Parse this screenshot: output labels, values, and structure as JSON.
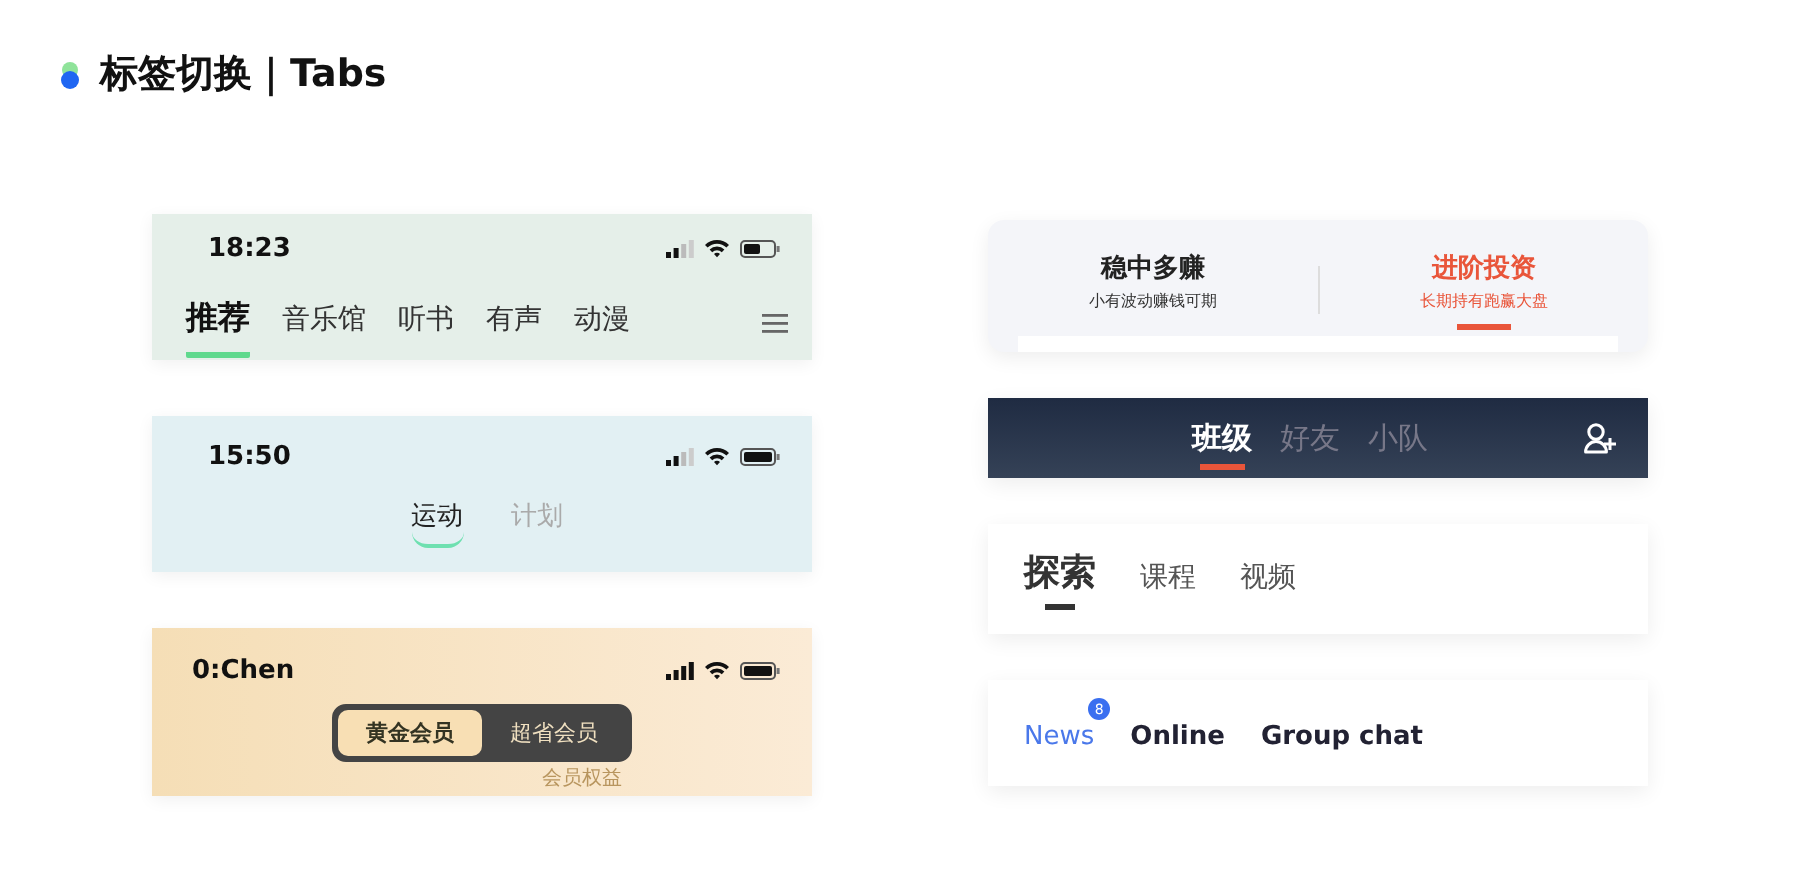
{
  "header": {
    "title": "标签切换｜Tabs"
  },
  "left": [
    {
      "kind": "scroll",
      "time": "18:23",
      "tabs": [
        {
          "label": "推荐",
          "selected": true
        },
        {
          "label": "音乐馆",
          "selected": false
        },
        {
          "label": "听书",
          "selected": false
        },
        {
          "label": "有声",
          "selected": false
        },
        {
          "label": "动漫",
          "selected": false
        }
      ]
    },
    {
      "kind": "centered",
      "time": "15:50",
      "tabs": [
        {
          "label": "运动",
          "selected": true
        },
        {
          "label": "计划",
          "selected": false
        }
      ]
    },
    {
      "kind": "segmented",
      "time": "0:Chen",
      "tabs": [
        {
          "label": "黄金会员",
          "selected": true
        },
        {
          "label": "超省会员",
          "selected": false
        }
      ],
      "faint_text": "会员权益"
    }
  ],
  "right": [
    {
      "kind": "subtitle",
      "tabs": [
        {
          "label": "稳中多赚",
          "subtitle": "小有波动赚钱可期",
          "selected": false
        },
        {
          "label": "进阶投资",
          "subtitle": "长期持有跑赢大盘",
          "selected": true
        }
      ]
    },
    {
      "kind": "dark",
      "tabs": [
        {
          "label": "班级",
          "selected": true
        },
        {
          "label": "好友",
          "selected": false
        },
        {
          "label": "小队",
          "selected": false
        }
      ]
    },
    {
      "kind": "bold",
      "tabs": [
        {
          "label": "探索",
          "selected": true
        },
        {
          "label": "课程",
          "selected": false
        },
        {
          "label": "视频",
          "selected": false
        }
      ]
    },
    {
      "kind": "badge",
      "tabs": [
        {
          "label": "News",
          "selected": true,
          "badge": "8"
        },
        {
          "label": "Online",
          "selected": false
        },
        {
          "label": "Group chat",
          "selected": false
        }
      ]
    }
  ]
}
